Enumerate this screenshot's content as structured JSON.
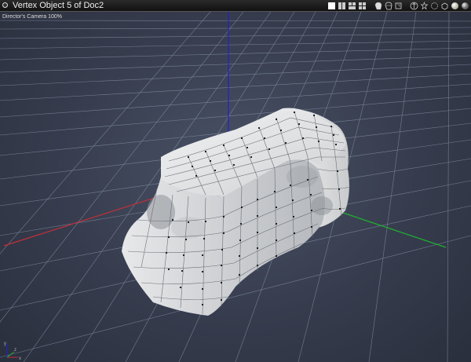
{
  "window": {
    "title": "Vertex Object 5 of Doc2"
  },
  "viewport": {
    "camera_label": "Director's Camera 100%"
  },
  "toolbar": {
    "icons": [
      "single-view-icon",
      "two-view-icon",
      "three-view-icon",
      "four-view-icon",
      "shaded-head-icon",
      "wire-head-icon",
      "box-head-icon",
      "pan-camera-icon",
      "rotate-camera-icon",
      "dolly-camera-icon",
      "frame-object-icon",
      "light-sphere-icon",
      "material-sphere-icon"
    ]
  },
  "colors": {
    "x_axis": "#c0303a",
    "y_axis": "#2020d0",
    "z_axis": "#20b030",
    "grid": "#8f9ab0",
    "background": "#3c4252",
    "mesh": "#dcdedf"
  }
}
